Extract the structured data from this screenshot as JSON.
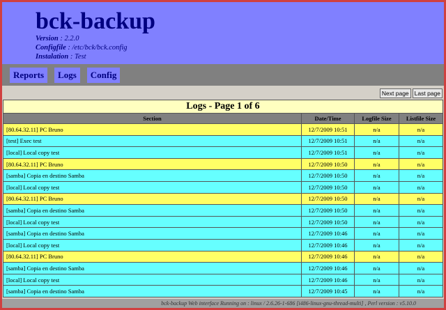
{
  "header": {
    "title": "bck-backup",
    "version_label": "Version",
    "version": "2.2.0",
    "configfile_label": "Configfile",
    "configfile": "/etc/bck/bck.config",
    "instalation_label": "Instalation",
    "instalation": "Test"
  },
  "nav": [
    "Reports",
    "Logs",
    "Config"
  ],
  "pager": {
    "next": "Next page",
    "last": "Last page"
  },
  "table": {
    "caption": "Logs - Page 1 of 6",
    "columns": [
      "Section",
      "Date/Time",
      "Logfile Size",
      "Listfile Size"
    ],
    "rows": [
      [
        "[80.64.32.11] PC Bruno",
        "12/7/2009 10:51",
        "n/a",
        "n/a",
        "y"
      ],
      [
        "[test] Exec test",
        "12/7/2009 10:51",
        "n/a",
        "n/a",
        "c"
      ],
      [
        "[local] Local copy test",
        "12/7/2009 10:51",
        "n/a",
        "n/a",
        "c"
      ],
      [
        "[80.64.32.11] PC Bruno",
        "12/7/2009 10:50",
        "n/a",
        "n/a",
        "y"
      ],
      [
        "[samba] Copia en destino Samba",
        "12/7/2009 10:50",
        "n/a",
        "n/a",
        "c"
      ],
      [
        "[local] Local copy test",
        "12/7/2009 10:50",
        "n/a",
        "n/a",
        "c"
      ],
      [
        "[80.64.32.11] PC Bruno",
        "12/7/2009 10:50",
        "n/a",
        "n/a",
        "y"
      ],
      [
        "[samba] Copia en destino Samba",
        "12/7/2009 10:50",
        "n/a",
        "n/a",
        "c"
      ],
      [
        "[local] Local copy test",
        "12/7/2009 10:50",
        "n/a",
        "n/a",
        "c"
      ],
      [
        "[samba] Copia en destino Samba",
        "12/7/2009 10:46",
        "n/a",
        "n/a",
        "c"
      ],
      [
        "[local] Local copy test",
        "12/7/2009 10:46",
        "n/a",
        "n/a",
        "c"
      ],
      [
        "[80.64.32.11] PC Bruno",
        "12/7/2009 10:46",
        "n/a",
        "n/a",
        "y"
      ],
      [
        "[samba] Copia en destino Samba",
        "12/7/2009 10:46",
        "n/a",
        "n/a",
        "c"
      ],
      [
        "[local] Local copy test",
        "12/7/2009 10:46",
        "n/a",
        "n/a",
        "c"
      ],
      [
        "[samba] Copia en destino Samba",
        "12/7/2009 10:45",
        "n/a",
        "n/a",
        "c"
      ]
    ]
  },
  "footer": "bck-backup Web interface Running on : linux / 2.6.26-1-686 [i486-linux-gnu-thread-multi] , Perl version : v5.10.0"
}
